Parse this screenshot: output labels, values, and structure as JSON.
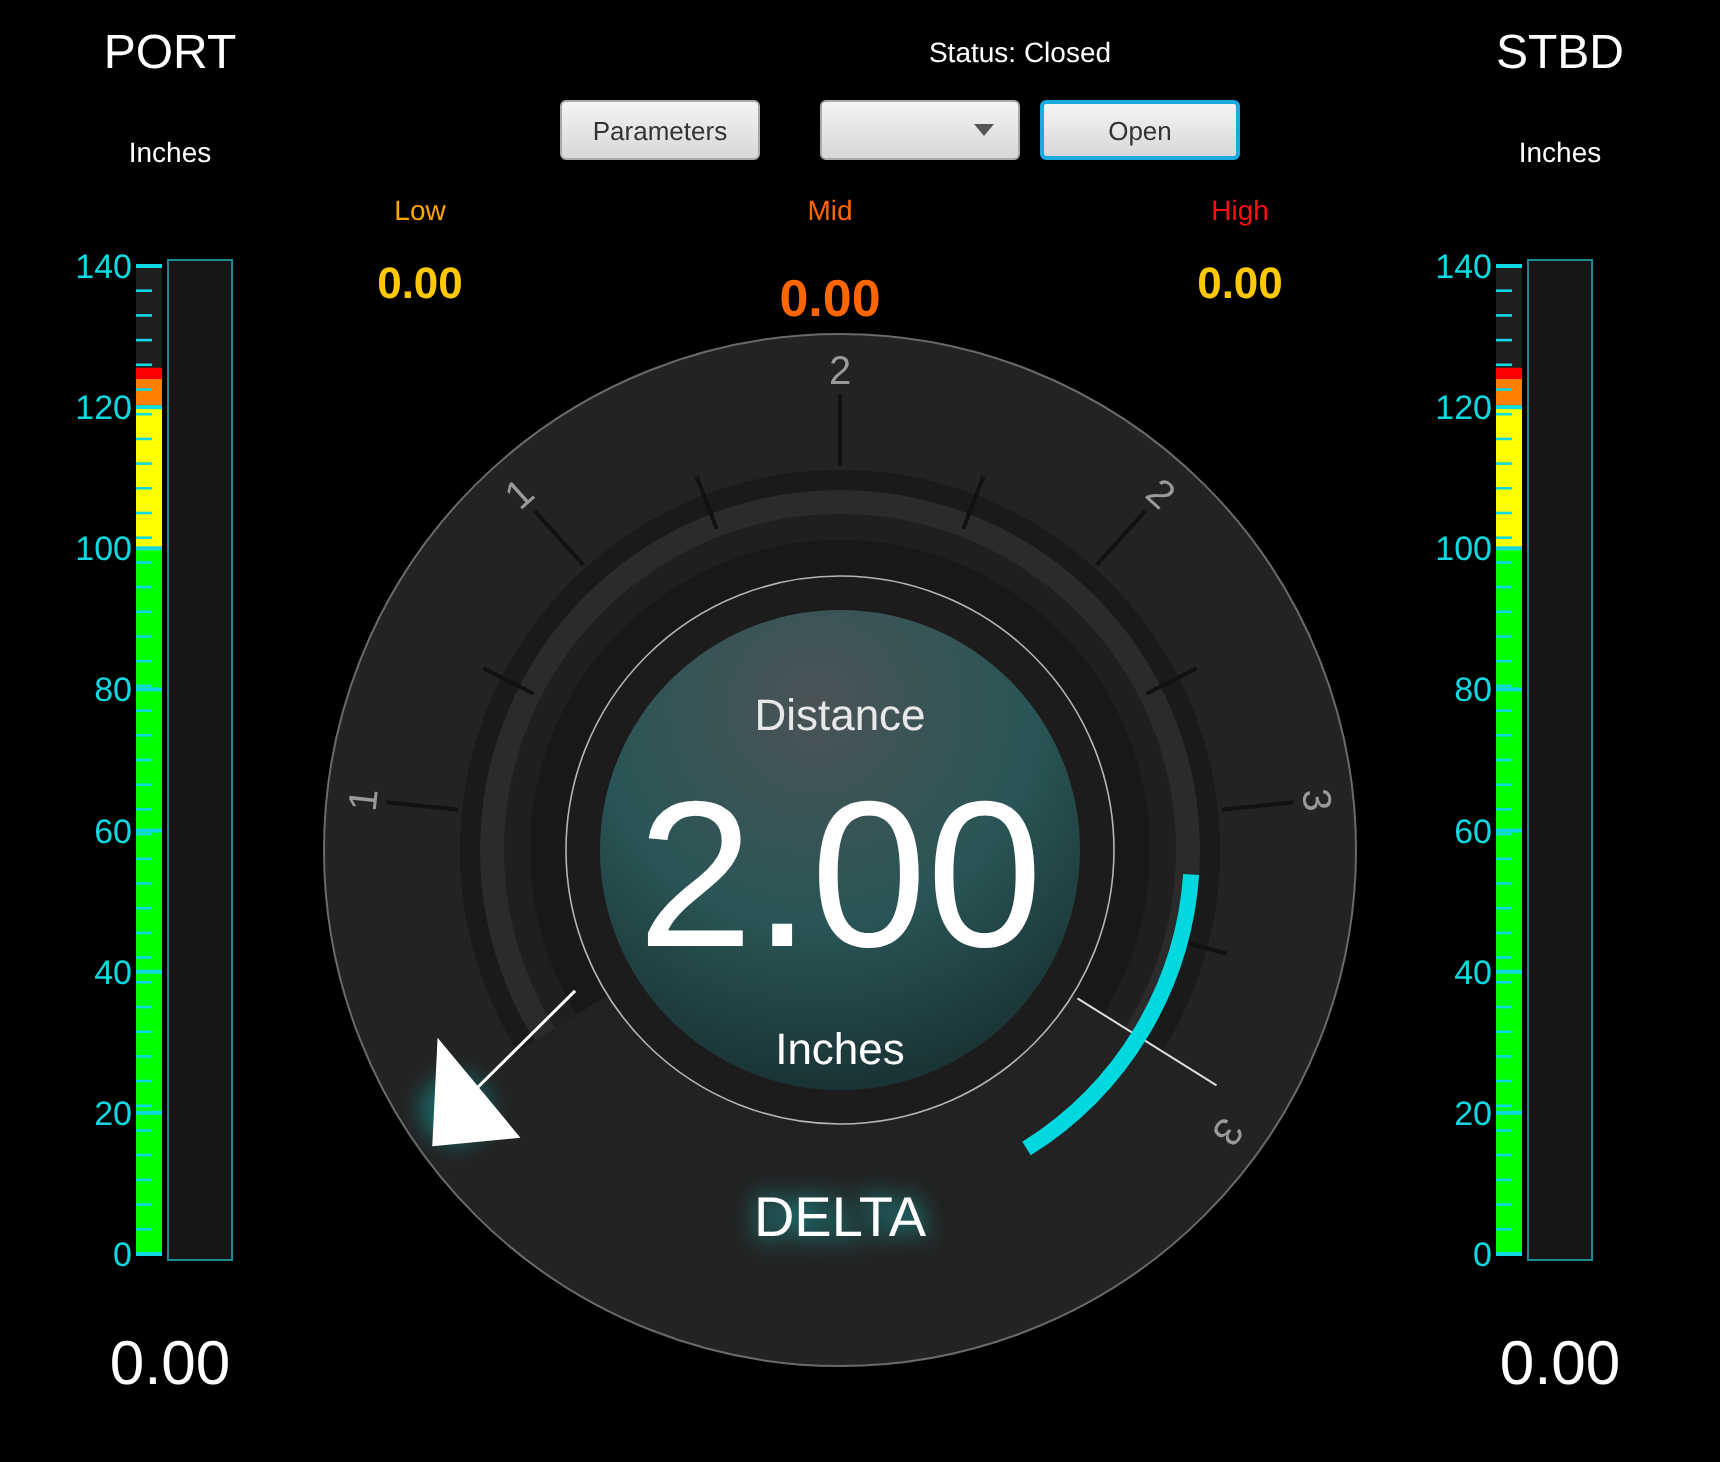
{
  "left_meter": {
    "title": "PORT",
    "unit": "Inches",
    "scale": [
      "140",
      "120",
      "100",
      "80",
      "60",
      "40",
      "20",
      "0"
    ],
    "level": 0.897,
    "reading": "0.00"
  },
  "status": "Status: Closed",
  "buttons": [
    {
      "kind": "button",
      "label": "Parameters",
      "focused": false
    },
    {
      "kind": "dropdown",
      "focused": false
    },
    {
      "kind": "button",
      "label": "Open",
      "focused": true
    }
  ],
  "thresholds": [
    {
      "label": "Low",
      "color": "#ffa500",
      "value": {
        "text": "0.00",
        "color": "#ffc800"
      }
    },
    {
      "label": "Mid",
      "color": "#ff6600",
      "value": {
        "text": "0.00",
        "color": "#ff6600"
      }
    },
    {
      "label": "High",
      "color": "#ff1010",
      "value": {
        "text": "0.00",
        "color": "#ffc800"
      }
    }
  ],
  "gauge": {
    "tick_labels": [
      "1",
      "1",
      "2",
      "2",
      "3",
      "3"
    ],
    "title": "Distance",
    "value": "2.00",
    "unit": "Inches",
    "mode": "DELTA"
  },
  "right_meter": {
    "title": "STBD",
    "unit": "Inches",
    "scale": [
      "140",
      "120",
      "100",
      "80",
      "60",
      "40",
      "20",
      "0"
    ],
    "level": 0.897,
    "reading": "0.00"
  }
}
